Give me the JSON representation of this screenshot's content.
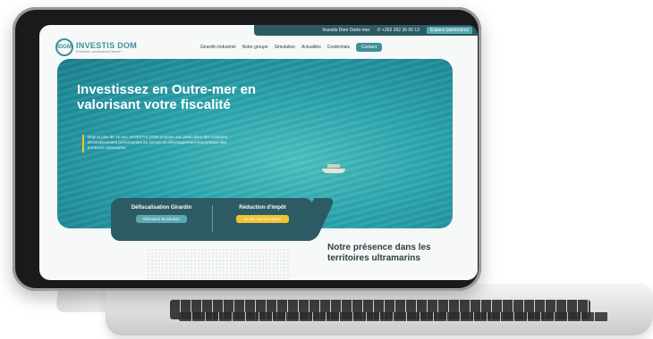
{
  "topbar": {
    "company": "Investis Dom Outre-mer",
    "phone": "+262 262 30 00 13",
    "contact": "Espace partenaires"
  },
  "header": {
    "logo_mark": "IDOM",
    "logo_name": "INVESTIS DOM",
    "logo_tagline": "Ensemble, construisons l'avenir !",
    "nav": [
      "Girardin Industriel",
      "Notre groupe",
      "Simulation",
      "Actualités",
      "Credentials"
    ],
    "nav_contact": "Contact"
  },
  "hero": {
    "title": "Investissez en Outre-mer en valorisant votre fiscalité",
    "description": "Depuis plus de 15 ans, INVESTIS DOM propose aux particuliers des solutions d'investissement performantes au service du développement économique des territoires ultramarins."
  },
  "cards": [
    {
      "title": "Défiscalisation Girardin",
      "button": "Découvrir la solution"
    },
    {
      "title": "Réduction d'impôt",
      "button": "Je fais ma simulation"
    }
  ],
  "section": {
    "title": "Notre présence dans les territoires ultramarins"
  },
  "colors": {
    "brand": "#3f8f98",
    "dark": "#2c5b63",
    "accent": "#f2c230"
  }
}
